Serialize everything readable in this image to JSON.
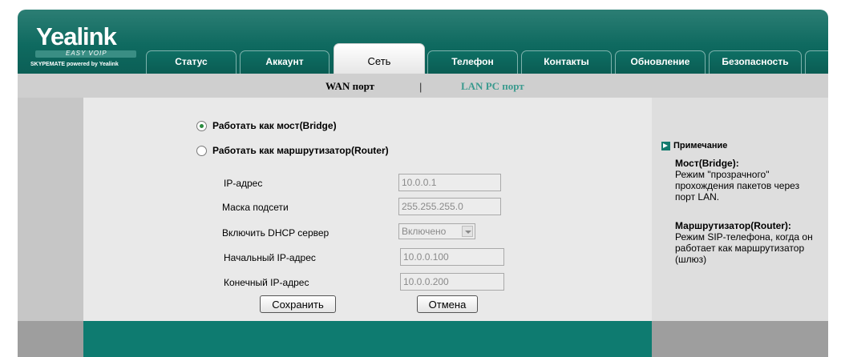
{
  "logo": {
    "word": "Yealink",
    "tag": "EASY VOIP",
    "sub": "SKYPEMATE powered by Yealink"
  },
  "tabs": [
    {
      "label": "Статус"
    },
    {
      "label": "Аккаунт"
    },
    {
      "label": "Сеть"
    },
    {
      "label": "Телефон"
    },
    {
      "label": "Контакты"
    },
    {
      "label": "Обновление"
    },
    {
      "label": "Безопасность"
    }
  ],
  "subnav": {
    "wan": "WAN порт",
    "sep": "|",
    "lan": "LAN PC порт",
    "active_color": "#000000",
    "inactive_color": "#3a9a8e"
  },
  "form": {
    "bridge_label": "Работать как мост(Bridge)",
    "router_label": "Работать как маршрутизатор(Router)",
    "ip_label": "IP-адрес",
    "ip_value": "10.0.0.1",
    "mask_label": "Маска подсети",
    "mask_value": "255.255.255.0",
    "dhcp_label": "Включить DHCP сервер",
    "dhcp_value": "Включено",
    "start_label": "Начальный IP-адрес",
    "start_value": "10.0.0.100",
    "end_label": "Конечный IP-адрес",
    "end_value": "10.0.0.200",
    "save": "Сохранить",
    "cancel": "Отмена"
  },
  "note": {
    "title": "Примечание",
    "bridge_head": "Мост(Bridge):",
    "bridge_text": "Режим \"прозрачного\" прохождения пакетов через порт LAN.",
    "router_head": "Маршрутизатор(Router):",
    "router_text": "Режим SIP-телефона, когда он работает как маршрутизатор (шлюз)"
  }
}
